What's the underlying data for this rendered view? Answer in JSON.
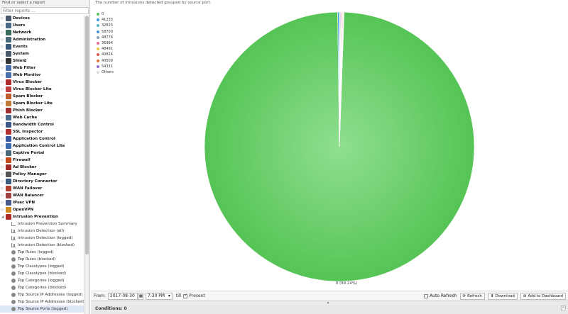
{
  "sidebar": {
    "header": "Find or select a report",
    "filter_placeholder": "Filter reports ...",
    "categories": [
      {
        "label": "Devices",
        "color": "#4a5a6a"
      },
      {
        "label": "Users",
        "color": "#4a6a8a"
      },
      {
        "label": "Network",
        "color": "#3a6a5a"
      },
      {
        "label": "Administration",
        "color": "#4a6a7a"
      },
      {
        "label": "Events",
        "color": "#3a5a7a"
      },
      {
        "label": "System",
        "color": "#4a5a6a"
      },
      {
        "label": "Shield",
        "color": "#333333"
      },
      {
        "label": "Web Filter",
        "color": "#4a6ea8"
      },
      {
        "label": "Web Monitor",
        "color": "#4a6ea8"
      },
      {
        "label": "Virus Blocker",
        "color": "#b02a2a"
      },
      {
        "label": "Virus Blocker Lite",
        "color": "#c04040"
      },
      {
        "label": "Spam Blocker",
        "color": "#c05a2a"
      },
      {
        "label": "Spam Blocker Lite",
        "color": "#c07a3a"
      },
      {
        "label": "Phish Blocker",
        "color": "#a03030"
      },
      {
        "label": "Web Cache",
        "color": "#4a6a8a"
      },
      {
        "label": "Bandwidth Control",
        "color": "#3a5a8a"
      },
      {
        "label": "SSL Inspector",
        "color": "#b03030"
      },
      {
        "label": "Application Control",
        "color": "#3a5aa0"
      },
      {
        "label": "Application Control Lite",
        "color": "#3a6ab0"
      },
      {
        "label": "Captive Portal",
        "color": "#4a6a7a"
      },
      {
        "label": "Firewall",
        "color": "#c04a1a"
      },
      {
        "label": "Ad Blocker",
        "color": "#a02a2a"
      },
      {
        "label": "Policy Manager",
        "color": "#555555"
      },
      {
        "label": "Directory Connector",
        "color": "#3a5a7a"
      },
      {
        "label": "WAN Failover",
        "color": "#b04030"
      },
      {
        "label": "WAN Balancer",
        "color": "#a04040"
      },
      {
        "label": "IPsec VPN",
        "color": "#4a5a8a"
      },
      {
        "label": "OpenVPN",
        "color": "#d08a20"
      },
      {
        "label": "Intrusion Prevention",
        "color": "#b02a2a"
      }
    ],
    "subitems": [
      {
        "label": "Intrusion Prevention Summary",
        "icon": "list"
      },
      {
        "label": "Intrusion Detection (all)",
        "icon": "bars"
      },
      {
        "label": "Intrusion Detection (logged)",
        "icon": "bars"
      },
      {
        "label": "Intrusion Detection (blocked)",
        "icon": "bars"
      },
      {
        "label": "Top Rules (logged)",
        "icon": "pie"
      },
      {
        "label": "Top Rules (blocked)",
        "icon": "pie"
      },
      {
        "label": "Top Classtypes (logged)",
        "icon": "pie"
      },
      {
        "label": "Top Classtypes (blocked)",
        "icon": "pie"
      },
      {
        "label": "Top Categories (logged)",
        "icon": "pie"
      },
      {
        "label": "Top Categories (blocked)",
        "icon": "pie"
      },
      {
        "label": "Top Source IP Addresses (logged)",
        "icon": "pie"
      },
      {
        "label": "Top Source IP Addresses (blocked)",
        "icon": "pie"
      },
      {
        "label": "Top Source Ports (logged)",
        "icon": "pie",
        "selected": true
      }
    ]
  },
  "report": {
    "description": "The number of intrusions detected grouped by source port."
  },
  "chart_data": {
    "type": "pie",
    "title": "",
    "legend_position": "top-left",
    "slices": [
      {
        "label": "0",
        "value": 99.24,
        "color": "#5cc85c"
      },
      {
        "label": "41233",
        "value": 0.15,
        "color": "#3a9be0"
      },
      {
        "label": "32825",
        "value": 0.1,
        "color": "#5ab5c8"
      },
      {
        "label": "58700",
        "value": 0.08,
        "color": "#4a90d0"
      },
      {
        "label": "48776",
        "value": 0.08,
        "color": "#8aa0b8"
      },
      {
        "label": "36984",
        "value": 0.08,
        "color": "#e06a9a"
      },
      {
        "label": "48491",
        "value": 0.07,
        "color": "#f0c840"
      },
      {
        "label": "40824",
        "value": 0.07,
        "color": "#e05a4a"
      },
      {
        "label": "40509",
        "value": 0.06,
        "color": "#e0783a"
      },
      {
        "label": "54331",
        "value": 0.05,
        "color": "#9a6ad0"
      },
      {
        "label": "Others",
        "value": 0.02,
        "color": "#dddddd"
      }
    ],
    "data_label": "0 (99.24%)"
  },
  "toolbar": {
    "from_label": "From:",
    "from_date": "2017-08-30",
    "from_time": "7:30 PM",
    "till_label": "till",
    "present_label": "Present",
    "present_checked": true,
    "auto_refresh_label": "Auto Refresh",
    "refresh_label": "Refresh",
    "download_label": "Download",
    "add_dashboard_label": "Add to Dashboard"
  },
  "conditions": {
    "label": "Conditions: 0"
  }
}
